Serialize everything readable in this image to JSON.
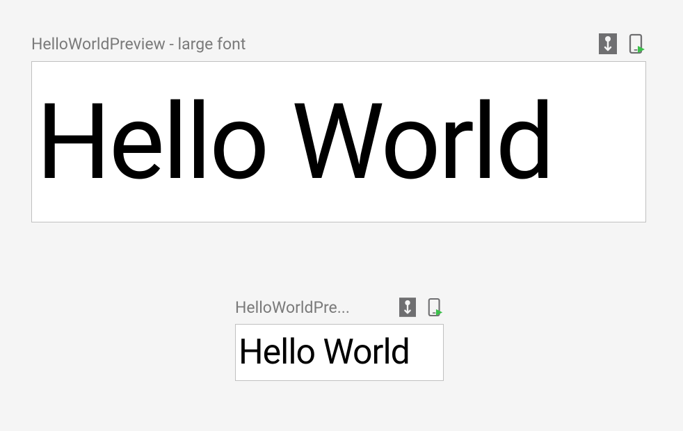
{
  "previews": {
    "large": {
      "title": "HelloWorldPreview - large font",
      "content": "Hello World"
    },
    "small": {
      "title": "HelloWorldPre...",
      "content": "Hello World"
    }
  }
}
